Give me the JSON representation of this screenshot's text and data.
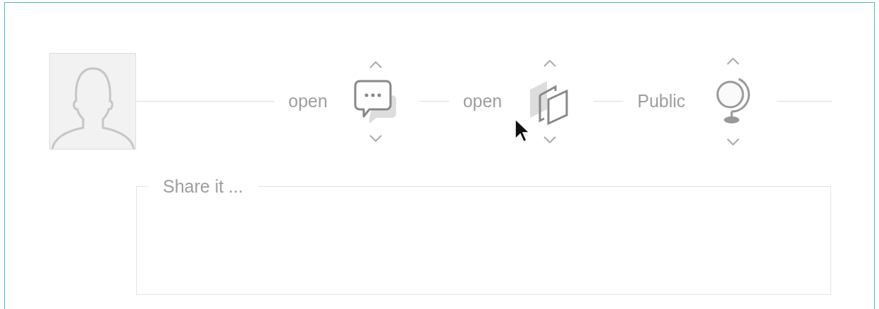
{
  "options": [
    {
      "kind": "comments",
      "label": "open"
    },
    {
      "kind": "copies",
      "label": "open"
    },
    {
      "kind": "visibility",
      "label": "Public"
    }
  ],
  "share_field": {
    "placeholder": "Share it ..."
  }
}
